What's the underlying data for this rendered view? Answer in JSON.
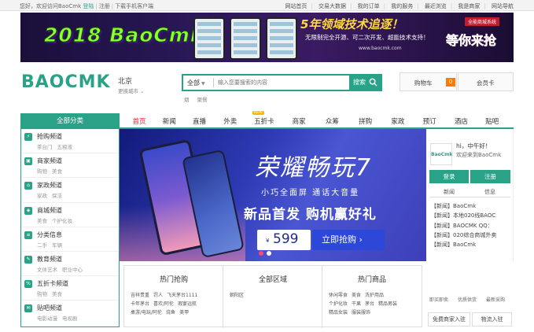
{
  "topbar": {
    "greeting": "您好，欢迎访问BaoCmk",
    "login": "登陆",
    "register": "注册",
    "download": "下载手机客户端",
    "links": [
      "网站首页",
      "交易大数据",
      "我的订单",
      "我的服务",
      "最近浏览",
      "我是商家",
      "网站导航"
    ]
  },
  "banner": {
    "title": "2018 BaoCmk",
    "slogan": "5年领域技术追逐！",
    "sub1": "无限制完全开源、可二次开发、超能技术支持！",
    "website": "www.baocmk.com",
    "tagline": "全能商城系统",
    "wait": "等你来抢"
  },
  "header": {
    "logo": "BAOCMK",
    "city": "北京",
    "city_switch": "更换城市",
    "search_category": "全部",
    "search_placeholder": "输入您要搜索的内容",
    "search_button": "搜索",
    "hotwords": [
      "烟",
      "聚餐"
    ],
    "cart_label": "购物车",
    "cart_count": "0",
    "member_card": "会员卡"
  },
  "nav": {
    "all": "全部分类",
    "items": [
      "首页",
      "新闻",
      "直播",
      "外卖",
      "五折卡",
      "商家",
      "众筹",
      "拼购",
      "家政",
      "预订",
      "酒店",
      "贴吧"
    ],
    "new_badge": "NEW"
  },
  "sidebar": {
    "categories": [
      {
        "name": "抢购频道",
        "subs": [
          "茶台门",
          "五粮液"
        ]
      },
      {
        "name": "商家频道",
        "subs": [
          "购物",
          "美食"
        ]
      },
      {
        "name": "家政频道",
        "subs": [
          "家政",
          "保洁"
        ]
      },
      {
        "name": "商城频道",
        "subs": [
          "美食",
          "个护化妆"
        ]
      },
      {
        "name": "分类信息",
        "subs": [
          "二手",
          "车辆"
        ]
      },
      {
        "name": "教育频道",
        "subs": [
          "文体艺术",
          "职业中心"
        ]
      },
      {
        "name": "五折卡频道",
        "subs": [
          "购物",
          "美食"
        ]
      },
      {
        "name": "贴吧频道",
        "subs": [
          "电影动漫",
          "电视剧"
        ]
      }
    ]
  },
  "hero": {
    "title": "荣耀畅玩7",
    "subtitle": "小巧全面屏 通话大音量",
    "headline": "新品首发 购机赢好礼",
    "currency": "¥",
    "price": "599",
    "buy": "立即抢购 ›"
  },
  "panel": {
    "avatar": "BaoCmk",
    "hi": "hi，中午好！",
    "welcome": "欢迎来到BaoCmk",
    "login": "登录",
    "register": "注册",
    "tab_news": "新闻",
    "tab_info": "信息",
    "news": [
      "【新闻】BaoCmk",
      "【新闻】本地020线BAOC",
      "【新闻】BAOCMK QQ：",
      "【新闻】020综合商城外卖",
      "【新闻】BaoCmk"
    ]
  },
  "modules": {
    "hot_deals": {
      "title": "热门抢购",
      "rows": [
        [
          "吉祥贵重",
          "罚人",
          "飞天茅台1111"
        ],
        [
          "卡年茅台",
          "喜欢/阿伦",
          "瑕宴远航"
        ],
        [
          "桌游/电玩/阿伦",
          "烧鱼",
          "美甲"
        ]
      ]
    },
    "areas": {
      "title": "全部区域",
      "rows": [
        [
          "朝阳区"
        ]
      ]
    },
    "hot_goods": {
      "title": "热门商品",
      "rows": [
        [
          "休闲零食",
          "美食",
          "洗护用品"
        ],
        [
          "个护化妆",
          "干果",
          "茅台",
          "精品男装"
        ],
        [
          "精品女装",
          "服装服饰"
        ]
      ]
    }
  },
  "right_grid": {
    "row1": [
      "即买即卖",
      "优质供货",
      "最新采购"
    ],
    "btn1": "免费商家入驻",
    "btn2": "物流入驻"
  }
}
